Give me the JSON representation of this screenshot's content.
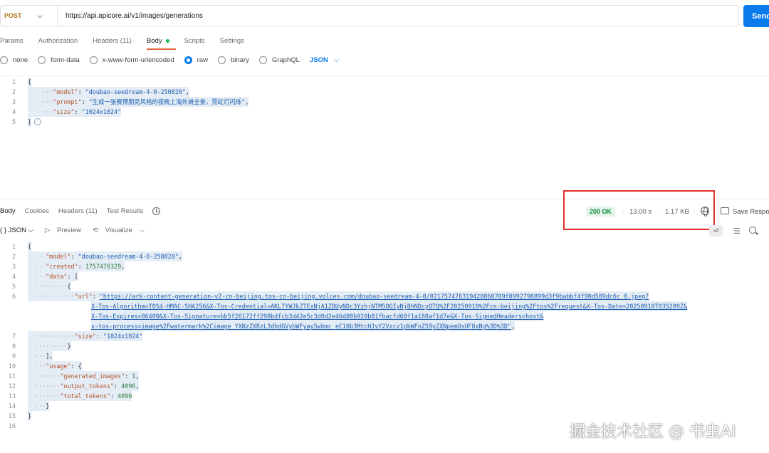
{
  "request": {
    "method": "POST",
    "url": "https://api.apicore.ai/v1/images/generations",
    "send_label": "Send"
  },
  "request_tabs": [
    "Params",
    "Authorization",
    "Headers (11)",
    "Body",
    "Scripts",
    "Settings"
  ],
  "body_types": {
    "options": [
      "none",
      "form-data",
      "x-www-form-urlencoded",
      "raw",
      "binary",
      "GraphQL"
    ],
    "selected": "raw",
    "format": "JSON"
  },
  "request_body": {
    "line_numbers": [
      "1",
      "2",
      "3",
      "4",
      "5"
    ],
    "model_key": "\"model\"",
    "model_val": "\"doubao-seedream-4-0-250828\"",
    "prompt_key": "\"prompt\"",
    "prompt_val": "\"生成一张赛博朋克风格的夜晚上海外滩全景，霓虹灯闪烁\"",
    "size_key": "\"size\"",
    "size_val": "\"1024x1024\""
  },
  "response_tabs": [
    "Body",
    "Cookies",
    "Headers (11)",
    "Test Results"
  ],
  "response_meta": {
    "status": "200 OK",
    "time": "13.00 s",
    "size": "1.17 KB",
    "save_label": "Save Response"
  },
  "response_toolbar": {
    "format": "JSON",
    "preview": "Preview",
    "visualize": "Visualize"
  },
  "response_body": {
    "line_numbers": [
      "1",
      "2",
      "3",
      "4",
      "5",
      "6",
      "7",
      "8",
      "9",
      "10",
      "11",
      "12",
      "13",
      "14",
      "15",
      "16"
    ],
    "model_key": "\"model\"",
    "model_val": "\"doubao-seedream-4-0-250828\"",
    "created_key": "\"created\"",
    "created_val": "1757476329",
    "data_key": "\"data\"",
    "url_key": "\"url\"",
    "url_line1": "\"https://ark-content-generation-v2-cn-beijing.tos-cn-beijing.volces.com/doubao-seedream-4-0/021757476319428860709f8992798899d3f9babbf4f90d589dc6c_0.jpeg?",
    "url_line2": "X-Tos-Algorithm=TOS4-HMAC-SHA256&X-Tos-Credential=AKLTYWJkZTExNjA1ZDUyNDc3YzhjNTM5OGIyNjBhNDcyOTQ%2F20250910%2Fcn-beijing%2Ftos%2Frequest&X-Tos-Date=20250910T035209Z&",
    "url_line3": "X-Tos-Expires=86400&X-Tos-Signature=bb5f26172ff298bdfcb3d42e5c3d0d2e46d80b928b81fbacfd60f1a188af1d7e&X-Tos-SignedHeaders=host&",
    "url_line4": "x-tos-process=image%2Fwatermark%2Cimage_YXNzZXRzL3dhdGVybWFyay5wbmc_eC10b3MtcHJvY2Vzcz1pbWFnZS9yZXNpemUsUF8xNg%3D%3D\"",
    "size_key": "\"size\"",
    "size_val": "\"1024x1024\"",
    "usage_key": "\"usage\"",
    "gen_key": "\"generated_images\"",
    "gen_val": "1",
    "out_key": "\"output_tokens\"",
    "out_val": "4096",
    "total_key": "\"total_tokens\"",
    "total_val": "4096"
  },
  "watermark": "掘金技术社区 @ 书虫AI",
  "colors": {
    "accent": "#097bed",
    "method": "#b0761a",
    "status_bg": "#e4f4e8",
    "status_text": "#0b8a3e",
    "highlight_box": "#e2302c",
    "tab_underline": "#e8683a"
  }
}
